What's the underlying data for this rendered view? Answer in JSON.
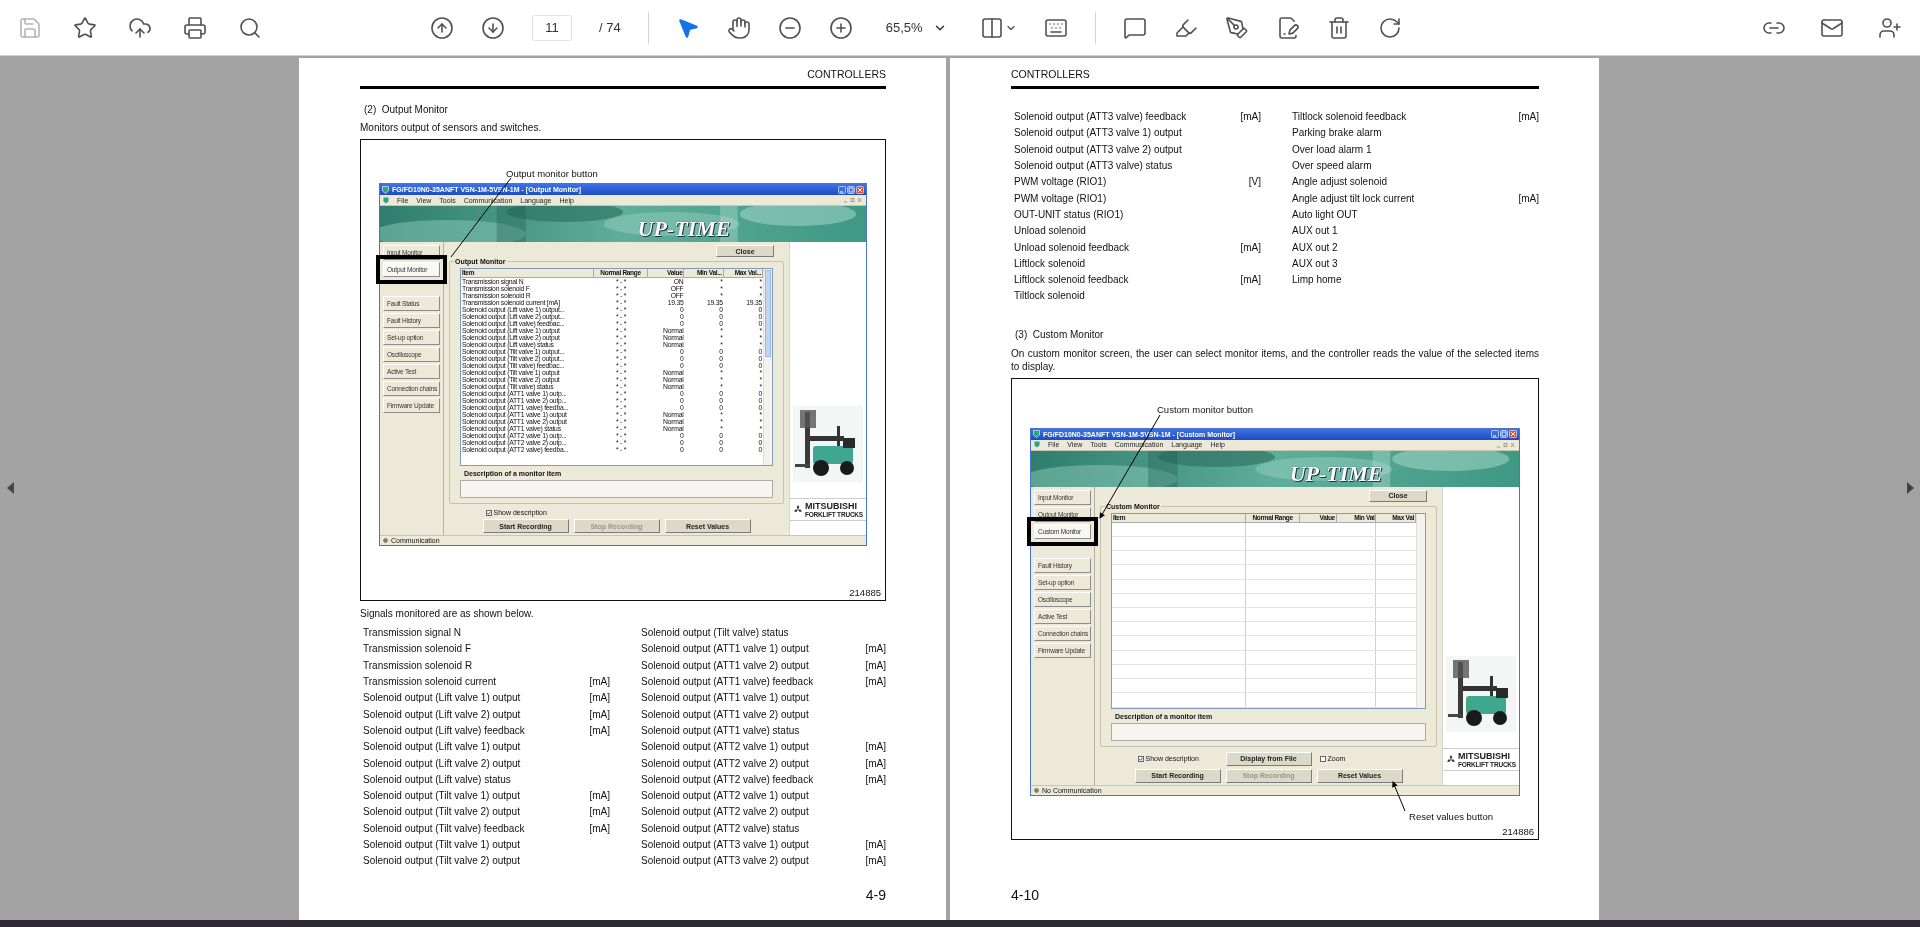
{
  "toolbar": {
    "page": "11",
    "page_count": "/ 74",
    "zoom": "65,5%"
  },
  "pages": [
    {
      "header": "CONTROLLERS",
      "page_number": "4-9",
      "blocks": [
        {
          "kind": "section_title",
          "text": "(2)  Output Monitor"
        },
        {
          "kind": "paragraph",
          "text": "Monitors output of sensors and switches."
        },
        {
          "kind": "figure",
          "number": "214885",
          "callouts": [
            {
              "kind": "above",
              "label": "Output monitor button"
            }
          ],
          "app": {
            "title": "FG/FD10N0-35ANFT VSN-1M-5VSN-1M - [Output Monitor]",
            "menu": [
              "File",
              "View",
              "Tools",
              "Communication",
              "Language",
              "Help"
            ],
            "banner": "UP-TIME",
            "sidebar": [
              {
                "label": "Input Monitor",
                "selected": false
              },
              {
                "label": "Output Monitor",
                "selected": true
              },
              {
                "label": "Fault Status",
                "selected": false
              },
              {
                "label": "Fault History",
                "selected": false
              },
              {
                "label": "Set-up option",
                "selected": false
              },
              {
                "label": "Oscilloscope",
                "selected": false
              },
              {
                "label": "Active Test",
                "selected": false
              },
              {
                "label": "Connection chains",
                "selected": false
              },
              {
                "label": "Firmware Update",
                "selected": false
              }
            ],
            "close": "Close",
            "group": "Output Monitor",
            "columns": [
              "Item",
              "Normal Range",
              "Value",
              "Min Val...",
              "Max Val..."
            ],
            "rows": [
              [
                "Transmission signal N",
                "* - *",
                "ON",
                "*",
                "*"
              ],
              [
                "Transmission solenoid F",
                "* - *",
                "OFF",
                "*",
                "*"
              ],
              [
                "Transmission solenoid R",
                "* - *",
                "OFF",
                "*",
                "*"
              ],
              [
                "Transmission solenoid current [mA]",
                "* - *",
                "19.35",
                "19.35",
                "19.35"
              ],
              [
                "Solenoid output (Lift valve 1) output...",
                "* - *",
                "0",
                "0",
                "0"
              ],
              [
                "Solenoid output (Lift valve 2) output...",
                "* - *",
                "0",
                "0",
                "0"
              ],
              [
                "Solenoid output (Lift valve) feedbac...",
                "* - *",
                "0",
                "0",
                "0"
              ],
              [
                "Solenoid output (Lift valve 1) output",
                "* - *",
                "Normal",
                "*",
                "*"
              ],
              [
                "Solenoid output (Lift valve 2) output",
                "* - *",
                "Normal",
                "*",
                "*"
              ],
              [
                "Solenoid output (Lift valve) status",
                "* - *",
                "Normal",
                "*",
                "*"
              ],
              [
                "Solenoid output (Tilt valve 1) output...",
                "* - *",
                "0",
                "0",
                "0"
              ],
              [
                "Solenoid output (Tilt valve 2) output...",
                "* - *",
                "0",
                "0",
                "0"
              ],
              [
                "Solenoid output (Tilt valve) feedbac...",
                "* - *",
                "0",
                "0",
                "0"
              ],
              [
                "Solenoid output (Tilt valve 1) output",
                "* - *",
                "Normal",
                "*",
                "*"
              ],
              [
                "Solenoid output (Tilt valve 2) output",
                "* - *",
                "Normal",
                "*",
                "*"
              ],
              [
                "Solenoid output (Tilt valve) status",
                "* - *",
                "Normal",
                "*",
                "*"
              ],
              [
                "Solenoid output (ATT1 valve 1) outp...",
                "* - *",
                "0",
                "0",
                "0"
              ],
              [
                "Solenoid output (ATT1 valve 2) outp...",
                "* - *",
                "0",
                "0",
                "0"
              ],
              [
                "Solenoid output (ATT1 valve) feedba...",
                "* - *",
                "0",
                "0",
                "0"
              ],
              [
                "Solenoid output (ATT1 valve 1) output",
                "* - *",
                "Normal",
                "*",
                "*"
              ],
              [
                "Solenoid output (ATT1 valve 2) output",
                "* - *",
                "Normal",
                "*",
                "*"
              ],
              [
                "Solenoid output (ATT1 valve) status",
                "* - *",
                "Normal",
                "*",
                "*"
              ],
              [
                "Solenoid output (ATT2 valve 1) outp...",
                "* - *",
                "0",
                "0",
                "0"
              ],
              [
                "Solenoid output (ATT2 valve 2) outp...",
                "* - *",
                "0",
                "0",
                "0"
              ],
              [
                "Solenoid output (ATT2 valve) feedba...",
                "* - *",
                "0",
                "0",
                "0"
              ]
            ],
            "description_label": "Description of a monitor item",
            "controls": [
              [
                {
                  "kind": "checkbox",
                  "label": "Show description",
                  "checked": true
                }
              ],
              [
                {
                  "kind": "button",
                  "label": "Start Recording",
                  "disabled": false
                },
                {
                  "kind": "button",
                  "label": "Stop Recording",
                  "disabled": true
                },
                {
                  "kind": "button",
                  "label": "Reset Values",
                  "disabled": false
                }
              ]
            ],
            "status": "Communication",
            "logo": {
              "name": "MITSUBISHI",
              "sub": "FORKLIFT TRUCKS"
            }
          }
        },
        {
          "kind": "paragraph",
          "text": "Signals monitored are as shown below."
        },
        {
          "kind": "signal_table",
          "columns": [
            [
              {
                "name": "Transmission signal N"
              },
              {
                "name": "Transmission solenoid F"
              },
              {
                "name": "Transmission solenoid R"
              },
              {
                "name": "Transmission solenoid current",
                "unit": "[mA]"
              },
              {
                "name": "Solenoid output (Lift valve 1) output",
                "unit": "[mA]"
              },
              {
                "name": "Solenoid output (Lift valve 2) output",
                "unit": "[mA]"
              },
              {
                "name": "Solenoid output (Lift valve) feedback",
                "unit": "[mA]"
              },
              {
                "name": "Solenoid output (Lift valve 1) output"
              },
              {
                "name": "Solenoid output (Lift valve 2) output"
              },
              {
                "name": "Solenoid output (Lift valve) status"
              },
              {
                "name": "Solenoid output (Tilt valve 1) output",
                "unit": "[mA]"
              },
              {
                "name": "Solenoid output (Tilt valve 2) output",
                "unit": "[mA]"
              },
              {
                "name": "Solenoid output (Tilt valve) feedback",
                "unit": "[mA]"
              },
              {
                "name": "Solenoid output (Tilt valve 1) output"
              },
              {
                "name": "Solenoid output (Tilt valve 2) output"
              }
            ],
            [
              {
                "name": "Solenoid output (Tilt valve) status"
              },
              {
                "name": "Solenoid output (ATT1 valve 1) output",
                "unit": "[mA]"
              },
              {
                "name": "Solenoid output (ATT1 valve 2) output",
                "unit": "[mA]"
              },
              {
                "name": "Solenoid output (ATT1 valve) feedback",
                "unit": "[mA]"
              },
              {
                "name": "Solenoid output (ATT1 valve 1) output"
              },
              {
                "name": "Solenoid output (ATT1 valve 2) output"
              },
              {
                "name": "Solenoid output (ATT1 valve) status"
              },
              {
                "name": "Solenoid output (ATT2 valve 1) output",
                "unit": "[mA]"
              },
              {
                "name": "Solenoid output (ATT2 valve 2) output",
                "unit": "[mA]"
              },
              {
                "name": "Solenoid output (ATT2 valve) feedback",
                "unit": "[mA]"
              },
              {
                "name": "Solenoid output (ATT2 valve 1) output"
              },
              {
                "name": "Solenoid output (ATT2 valve 2) output"
              },
              {
                "name": "Solenoid output (ATT2 valve) status"
              },
              {
                "name": "Solenoid output (ATT3 valve 1) output",
                "unit": "[mA]"
              },
              {
                "name": "Solenoid output (ATT3 valve 2) output",
                "unit": "[mA]"
              }
            ]
          ]
        }
      ]
    },
    {
      "header": "CONTROLLERS",
      "page_number": "4-10",
      "blocks": [
        {
          "kind": "signal_table",
          "columns": [
            [
              {
                "name": "Solenoid output (ATT3 valve) feedback",
                "unit": "[mA]"
              },
              {
                "name": "Solenoid output (ATT3 valve 1) output"
              },
              {
                "name": "Solenoid output (ATT3 valve 2) output"
              },
              {
                "name": "Solenoid output (ATT3 valve) status"
              },
              {
                "name": "PWM voltage (RIO1)",
                "unit": "[V]"
              },
              {
                "name": "PWM voltage (RIO1)"
              },
              {
                "name": "OUT-UNIT status (RIO1)"
              },
              {
                "name": "Unload solenoid"
              },
              {
                "name": "Unload solenoid feedback",
                "unit": "[mA]"
              },
              {
                "name": "Liftlock solenoid"
              },
              {
                "name": "Liftlock solenoid feedback",
                "unit": "[mA]"
              },
              {
                "name": "Tiltlock solenoid"
              }
            ],
            [
              {
                "name": "Tiltlock solenoid feedback",
                "unit": "[mA]"
              },
              {
                "name": "Parking brake alarm"
              },
              {
                "name": "Over load alarm 1"
              },
              {
                "name": "Over speed alarm"
              },
              {
                "name": "Angle adjust solenoid"
              },
              {
                "name": "Angle adjust tilt lock current",
                "unit": "[mA]"
              },
              {
                "name": "Auto light OUT"
              },
              {
                "name": "AUX out 1"
              },
              {
                "name": "AUX out 2"
              },
              {
                "name": "AUX out 3"
              },
              {
                "name": "Limp home"
              }
            ]
          ]
        },
        {
          "kind": "section_title",
          "text": "(3)  Custom Monitor"
        },
        {
          "kind": "paragraph",
          "text": "On custom monitor screen, the user can select monitor items, and the controller reads the value of the selected items to display."
        },
        {
          "kind": "figure",
          "number": "214886",
          "callouts": [
            {
              "kind": "above",
              "label": "Custom monitor button"
            },
            {
              "kind": "below",
              "label": "Reset values button"
            }
          ],
          "app": {
            "title": "FG/FD10N0-35ANFT VSN-1M-5VSN-1M - [Custom Monitor]",
            "menu": [
              "File",
              "View",
              "Tools",
              "Communication",
              "Language",
              "Help"
            ],
            "banner": "UP-TIME",
            "sidebar": [
              {
                "label": "Input Monitor",
                "selected": false
              },
              {
                "label": "Output Monitor",
                "selected": false
              },
              {
                "label": "Custom Monitor",
                "selected": true
              },
              {
                "label": "Fault History",
                "selected": false
              },
              {
                "label": "Set-up option",
                "selected": false
              },
              {
                "label": "Oscilloscope",
                "selected": false
              },
              {
                "label": "Active Test",
                "selected": false
              },
              {
                "label": "Connection chains",
                "selected": false
              },
              {
                "label": "Firmware Update",
                "selected": false
              }
            ],
            "close": "Close",
            "group": "Custom Monitor",
            "columns": [
              "Item",
              "Normal Range",
              "Value",
              "Min Val",
              "Max Val"
            ],
            "description_label": "Description of a monitor item",
            "controls": [
              [
                {
                  "kind": "checkbox",
                  "label": "Show description",
                  "checked": true
                },
                {
                  "kind": "button",
                  "label": "Display from File",
                  "disabled": false
                },
                {
                  "kind": "checkbox",
                  "label": "Zoom",
                  "checked": false
                }
              ],
              [
                {
                  "kind": "button",
                  "label": "Start Recording",
                  "disabled": false
                },
                {
                  "kind": "button",
                  "label": "Stop Recording",
                  "disabled": true
                },
                {
                  "kind": "button",
                  "label": "Reset Values",
                  "disabled": false
                }
              ]
            ],
            "status": "No Communication",
            "logo": {
              "name": "MITSUBISHI",
              "sub": "FORKLIFT TRUCKS"
            }
          }
        }
      ]
    }
  ]
}
